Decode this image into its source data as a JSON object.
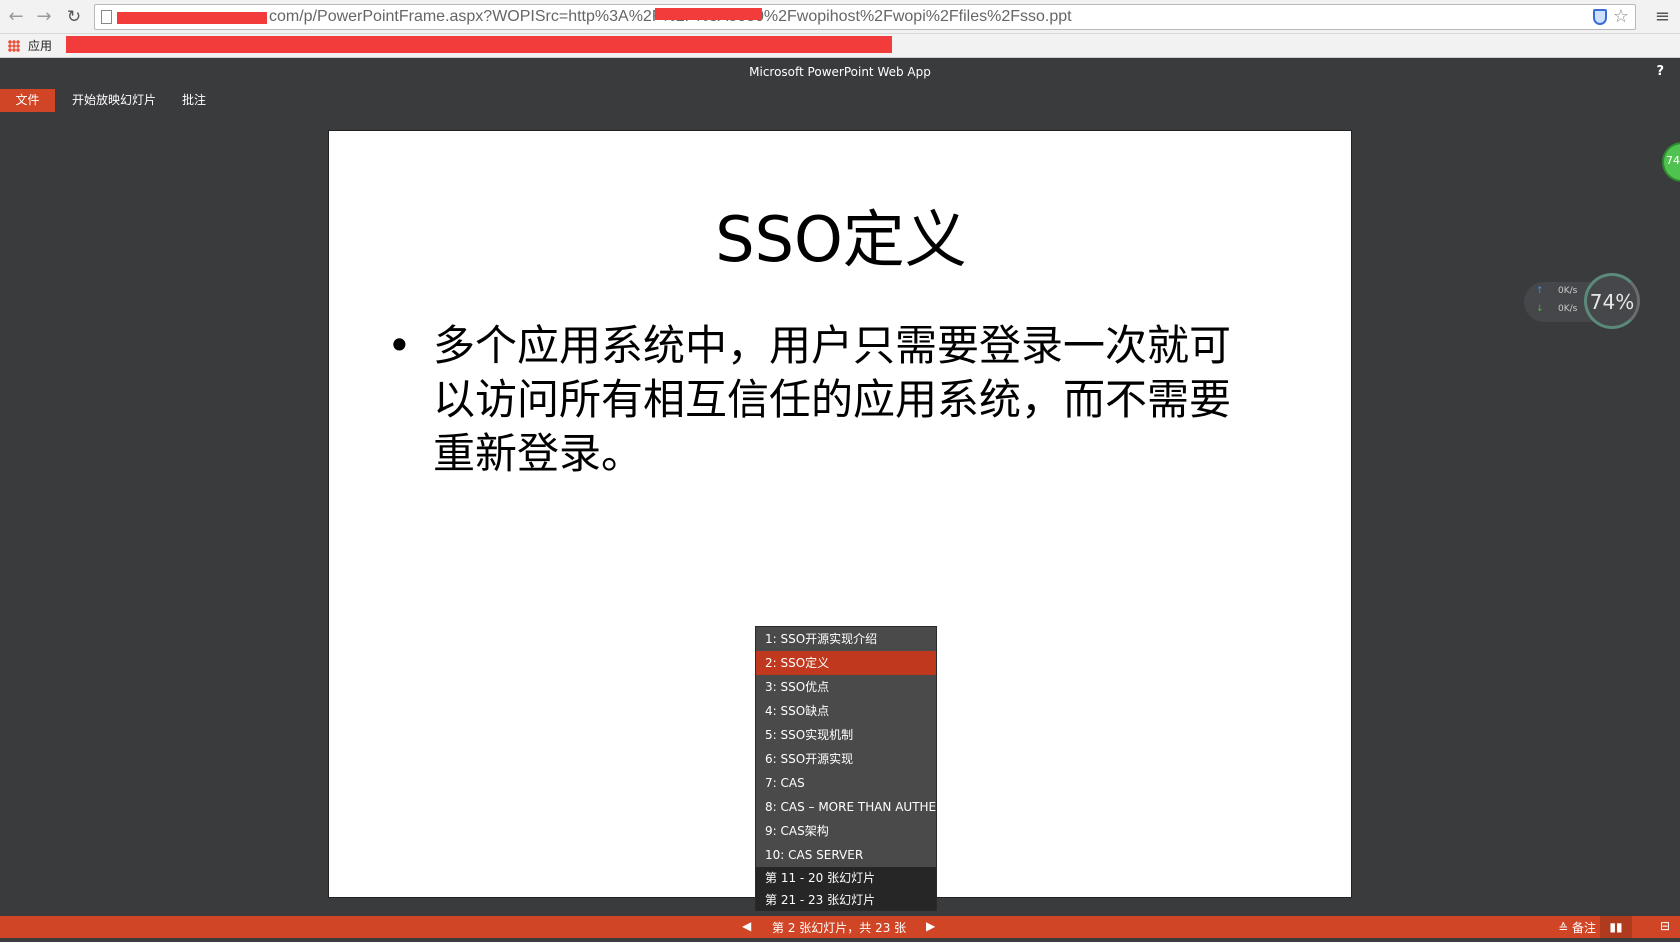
{
  "browser": {
    "url": "com/p/PowerPointFrame.aspx?WOPISrc=http%3A%2F%2F",
    "url_tail": "%3A8080%2Fwopihost%2Fwopi%2Ffiles%2Fsso.ppt",
    "back_icon": "back-arrow-icon",
    "forward_icon": "forward-arrow-icon",
    "reload_icon": "reload-icon",
    "bookmarks_apps_label": "应用"
  },
  "app": {
    "title": "Microsoft PowerPoint Web App",
    "help_label": "?"
  },
  "ribbon": {
    "file_tab": "文件",
    "slideshow_tab": "开始放映幻灯片",
    "comments_tab": "批注"
  },
  "slide": {
    "title": "SSO定义",
    "bullet_marker": "•",
    "bullet_text": "多个应用系统中，用户只需要登录一次就可以访问所有相互信任的应用系统，而不需要重新登录。"
  },
  "slide_list": {
    "items": [
      "1: SSO开源实现介绍",
      "2: SSO定义",
      "3: SSO优点",
      "4: SSO缺点",
      "5: SSO实现机制",
      "6: SSO开源实现",
      "7: CAS",
      "8: CAS – MORE THAN AUTHE",
      "9: CAS架构",
      "10: CAS SERVER"
    ],
    "active_index": 1,
    "groups": [
      "第 11 - 20 张幻灯片",
      "第 21 - 23 张幻灯片"
    ]
  },
  "status_bar": {
    "prev_glyph": "◀",
    "position_text": "第 2 张幻灯片，共 23 张",
    "next_glyph": "▶",
    "notes_label": "≙ 备注",
    "reading_label": "▮▮",
    "present_label": "⊟"
  },
  "widget": {
    "upload_speed": "0K/s",
    "download_speed": "0K/s",
    "gauge_value": "74%",
    "side_value": "74"
  },
  "colors": {
    "accent": "#d04525",
    "active_item": "#c0391f",
    "background": "#3a3b3d"
  }
}
